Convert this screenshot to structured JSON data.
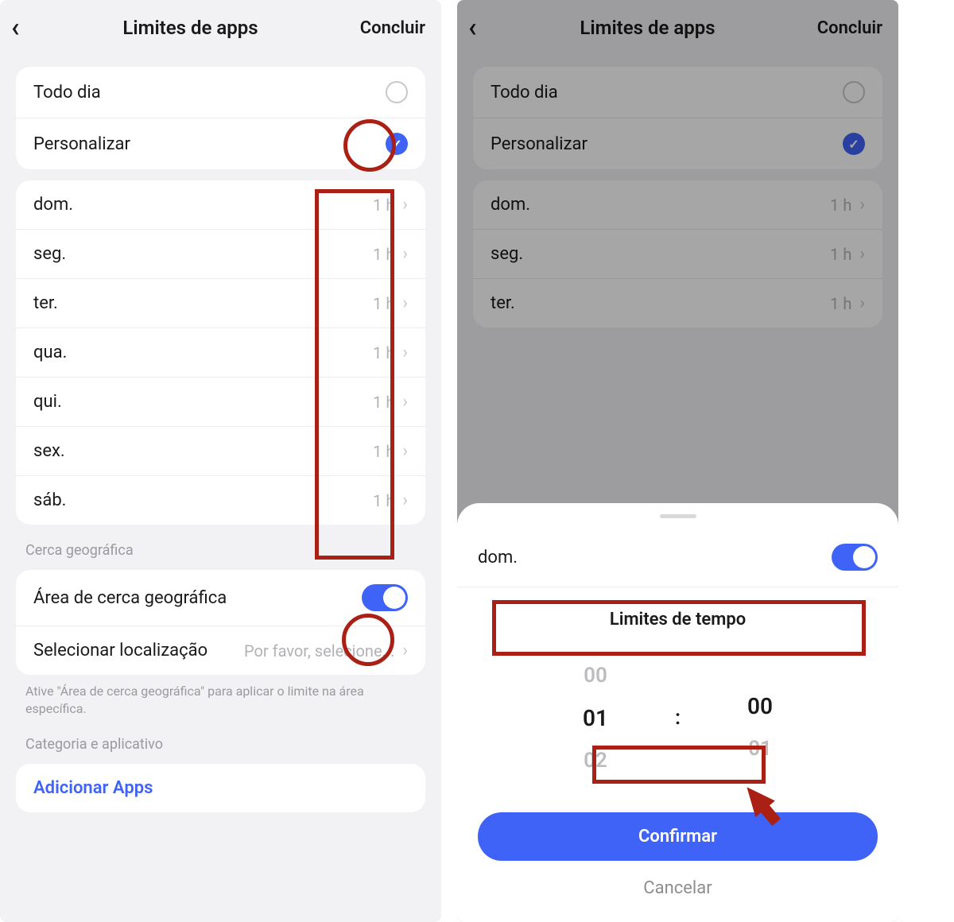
{
  "left": {
    "header": {
      "title": "Limites de apps",
      "done": "Concluir"
    },
    "modes": {
      "everyday": "Todo dia",
      "custom": "Personalizar"
    },
    "days": [
      {
        "name": "dom.",
        "value": "1 h"
      },
      {
        "name": "seg.",
        "value": "1 h"
      },
      {
        "name": "ter.",
        "value": "1 h"
      },
      {
        "name": "qua.",
        "value": "1 h"
      },
      {
        "name": "qui.",
        "value": "1 h"
      },
      {
        "name": "sex.",
        "value": "1 h"
      },
      {
        "name": "sáb.",
        "value": "1 h"
      }
    ],
    "geofence": {
      "section": "Cerca geográfica",
      "area": "Área de cerca geográfica",
      "select_location": "Selecionar localização",
      "select_placeholder": "Por favor, selecione...",
      "hint": "Ative \"Área de cerca geográfica\" para aplicar o limite na área específica."
    },
    "category_section": "Categoria e aplicativo",
    "add_apps": "Adicionar Apps"
  },
  "right": {
    "header": {
      "title": "Limites de apps",
      "done": "Concluir"
    },
    "modes": {
      "everyday": "Todo dia",
      "custom": "Personalizar"
    },
    "days": [
      {
        "name": "dom.",
        "value": "1 h"
      },
      {
        "name": "seg.",
        "value": "1 h"
      },
      {
        "name": "ter.",
        "value": "1 h"
      }
    ],
    "sheet": {
      "day": "dom.",
      "title": "Limites de tempo",
      "picker": {
        "hours_above": "00",
        "hours_sel": "01",
        "hours_below": "02",
        "colon": ":",
        "mins_above": "",
        "mins_sel": "00",
        "mins_below": "01"
      },
      "confirm": "Confirmar",
      "cancel": "Cancelar"
    }
  }
}
